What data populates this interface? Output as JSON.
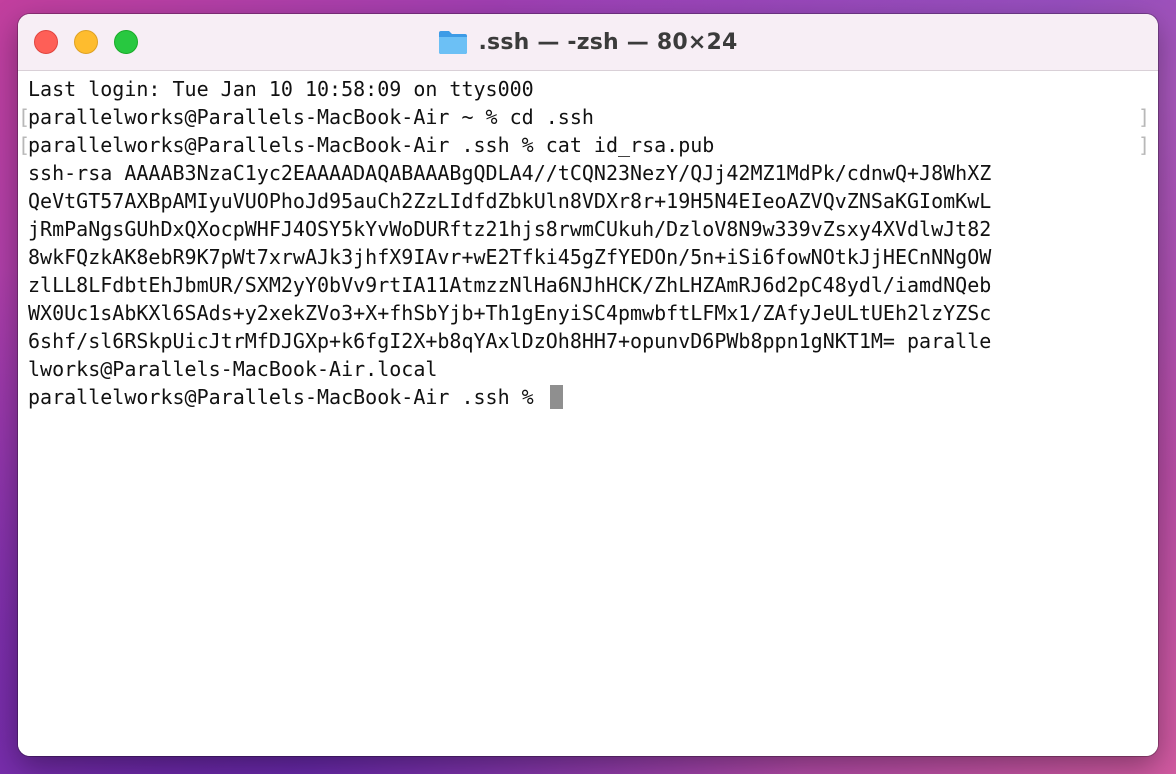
{
  "window": {
    "title": ".ssh — -zsh — 80×24",
    "icon": "folder-icon",
    "colors": {
      "close": "#fe5f57",
      "minimize": "#febc2e",
      "maximize": "#28c840"
    }
  },
  "terminal": {
    "lines": [
      {
        "text": "Last login: Tue Jan 10 10:58:09 on ttys000"
      },
      {
        "text": "parallelworks@Parallels-MacBook-Air ~ % cd .ssh"
      },
      {
        "text": "parallelworks@Parallels-MacBook-Air .ssh % cat id_rsa.pub"
      },
      {
        "text": "ssh-rsa AAAAB3NzaC1yc2EAAAADAQABAAABgQDLA4//tCQN23NezY/QJj42MZ1MdPk/cdnwQ+J8WhXZ"
      },
      {
        "text": "QeVtGT57AXBpAMIyuVUOPhoJd95auCh2ZzLIdfdZbkUln8VDXr8r+19H5N4EIeoAZVQvZNSaKGIomKwL"
      },
      {
        "text": "jRmPaNgsGUhDxQXocpWHFJ4OSY5kYvWoDURftz21hjs8rwmCUkuh/DzloV8N9w339vZsxy4XVdlwJt82"
      },
      {
        "text": "8wkFQzkAK8ebR9K7pWt7xrwAJk3jhfX9IAvr+wE2Tfki45gZfYEDOn/5n+iSi6fowNOtkJjHECnNNgOW"
      },
      {
        "text": "zlLL8LFdbtEhJbmUR/SXM2yY0bVv9rtIA11AtmzzNlHa6NJhHCK/ZhLHZAmRJ6d2pC48ydl/iamdNQeb"
      },
      {
        "text": "WX0Uc1sAbKXl6SAds+y2xekZVo3+X+fhSbYjb+Th1gEnyiSC4pmwbftLFMx1/ZAfyJeULtUEh2lzYZSc"
      },
      {
        "text": "6shf/sl6RSkpUicJtrMfDJGXp+k6fgI2X+b8qYAxlDzOh8HH7+opunvD6PWb8ppn1gNKT1M= paralle"
      },
      {
        "text": "lworks@Parallels-MacBook-Air.local"
      }
    ],
    "prompt": "parallelworks@Parallels-MacBook-Air .ssh % ",
    "bracket_left": "[",
    "bracket_right": "]"
  }
}
